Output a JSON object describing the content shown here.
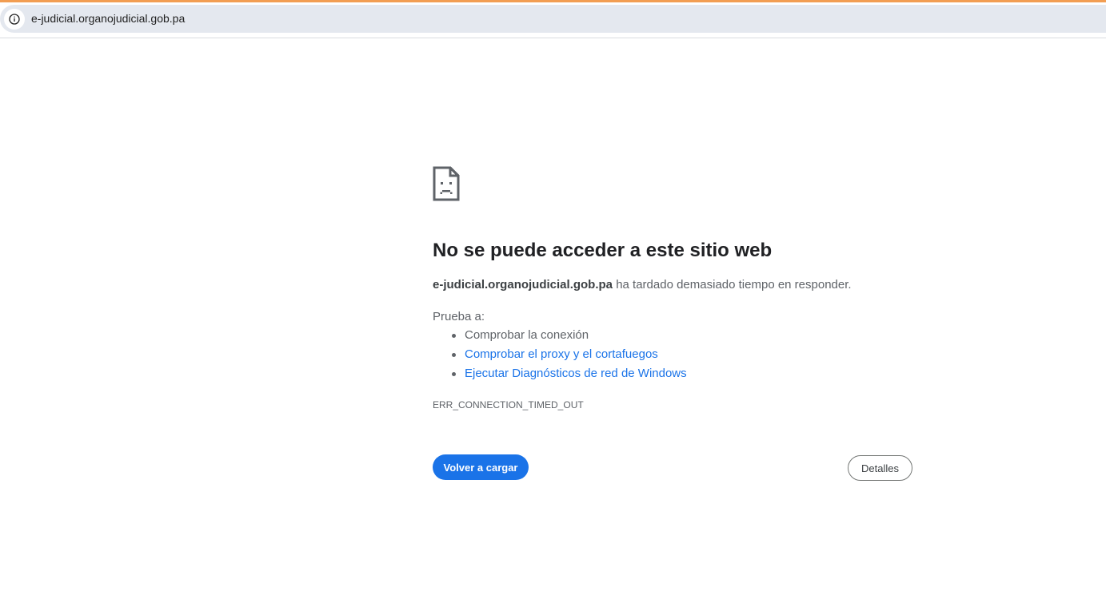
{
  "browser": {
    "url": "e-judicial.organojudicial.gob.pa",
    "info_icon": "info-circle-icon",
    "accent_color": "#f29d52"
  },
  "error_page": {
    "icon": "sad-page-icon",
    "title": "No se puede acceder a este sitio web",
    "host": "e-judicial.organojudicial.gob.pa",
    "description_suffix": " ha tardado demasiado tiempo en responder.",
    "try_label": "Prueba a:",
    "suggestions": [
      {
        "label": "Comprobar la conexión",
        "is_link": false
      },
      {
        "label": "Comprobar el proxy y el cortafuegos",
        "is_link": true
      },
      {
        "label": "Ejecutar Diagnósticos de red de Windows",
        "is_link": true
      }
    ],
    "error_code": "ERR_CONNECTION_TIMED_OUT",
    "reload_label": "Volver a cargar",
    "details_label": "Detalles",
    "primary_color": "#1a73e8",
    "link_color": "#1a73e8"
  }
}
